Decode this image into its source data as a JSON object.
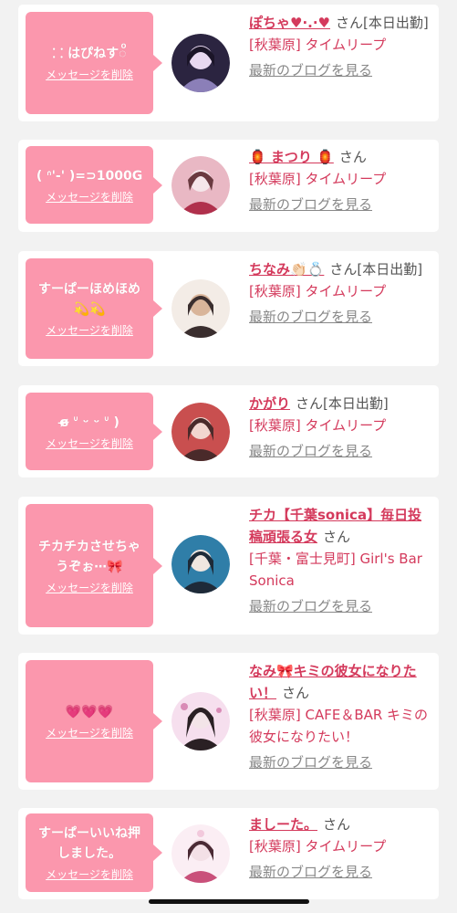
{
  "cards": [
    {
      "message": "⸬ はぴねす◌ͦ",
      "delete_label": "メッセージを削除",
      "name": "ぽちゃ♥·.·♥",
      "honorific": "さん",
      "status": "[本日出勤]",
      "shop": "[秋葉原] タイムリープ",
      "blog_label": "最新のブログを見る",
      "avatar_colors": [
        "#2b2440",
        "#8b7fb8",
        "#e8d8f0"
      ]
    },
    {
      "message": "( ᐢ'-' )=⊃1000G",
      "delete_label": "メッセージを削除",
      "name": "🏮 まつり 🏮",
      "honorific": "さん",
      "status": "",
      "shop": "[秋葉原] タイムリープ",
      "blog_label": "最新のブログを見る",
      "avatar_colors": [
        "#e9b8c4",
        "#b0304c",
        "#f5e6ea"
      ]
    },
    {
      "message": "すーぱーほめほめ💫💫",
      "delete_label": "メッセージを削除",
      "name": "ちなみ👏🏻💍",
      "honorific": "さん",
      "status": "[本日出勤]",
      "shop": "[秋葉原] タイムリープ",
      "blog_label": "最新のブログを見る",
      "avatar_colors": [
        "#3a2e2e",
        "#d9b59a",
        "#f3ece6"
      ]
    },
    {
      "message": "ɞ̴̶̷ ᐡ ᵕ ᵕ ᐡ )",
      "delete_label": "メッセージを削除",
      "name": "かがり",
      "honorific": "さん",
      "status": "[本日出勤]",
      "shop": "[秋葉原] タイムリープ",
      "blog_label": "最新のブログを見る",
      "avatar_colors": [
        "#4a2a2a",
        "#c94f4f",
        "#f2d6cf"
      ]
    },
    {
      "message": "チカチカさせちゃうぞぉ⋯🎀",
      "delete_label": "メッセージを削除",
      "name": "チカ【千葉sonica】毎日投稿頑張る女",
      "honorific": "さん",
      "status": "",
      "shop": "[千葉・富士見町] Girl's Bar Sonica",
      "blog_label": "最新のブログを見る",
      "avatar_colors": [
        "#2f7ea8",
        "#1e2a38",
        "#f0e6e0"
      ]
    },
    {
      "message": "💗💗💗",
      "delete_label": "メッセージを削除",
      "name": "なみ🎀キミの彼女になりたい！",
      "honorific": "さん",
      "status": "",
      "shop": "[秋葉原] CAFE＆BAR キミの彼女になりたい！",
      "blog_label": "最新のブログを見る",
      "avatar_colors": [
        "#f6dfee",
        "#2a2024",
        "#d98bb6"
      ]
    },
    {
      "message": "すーぱーいいね押しました。",
      "delete_label": "メッセージを削除",
      "name": "ましーた。",
      "honorific": "さん",
      "status": "",
      "shop": "[秋葉原] タイムリープ",
      "blog_label": "最新のブログを見る",
      "avatar_colors": [
        "#f2c9dc",
        "#c9507a",
        "#fbeef4"
      ]
    }
  ]
}
